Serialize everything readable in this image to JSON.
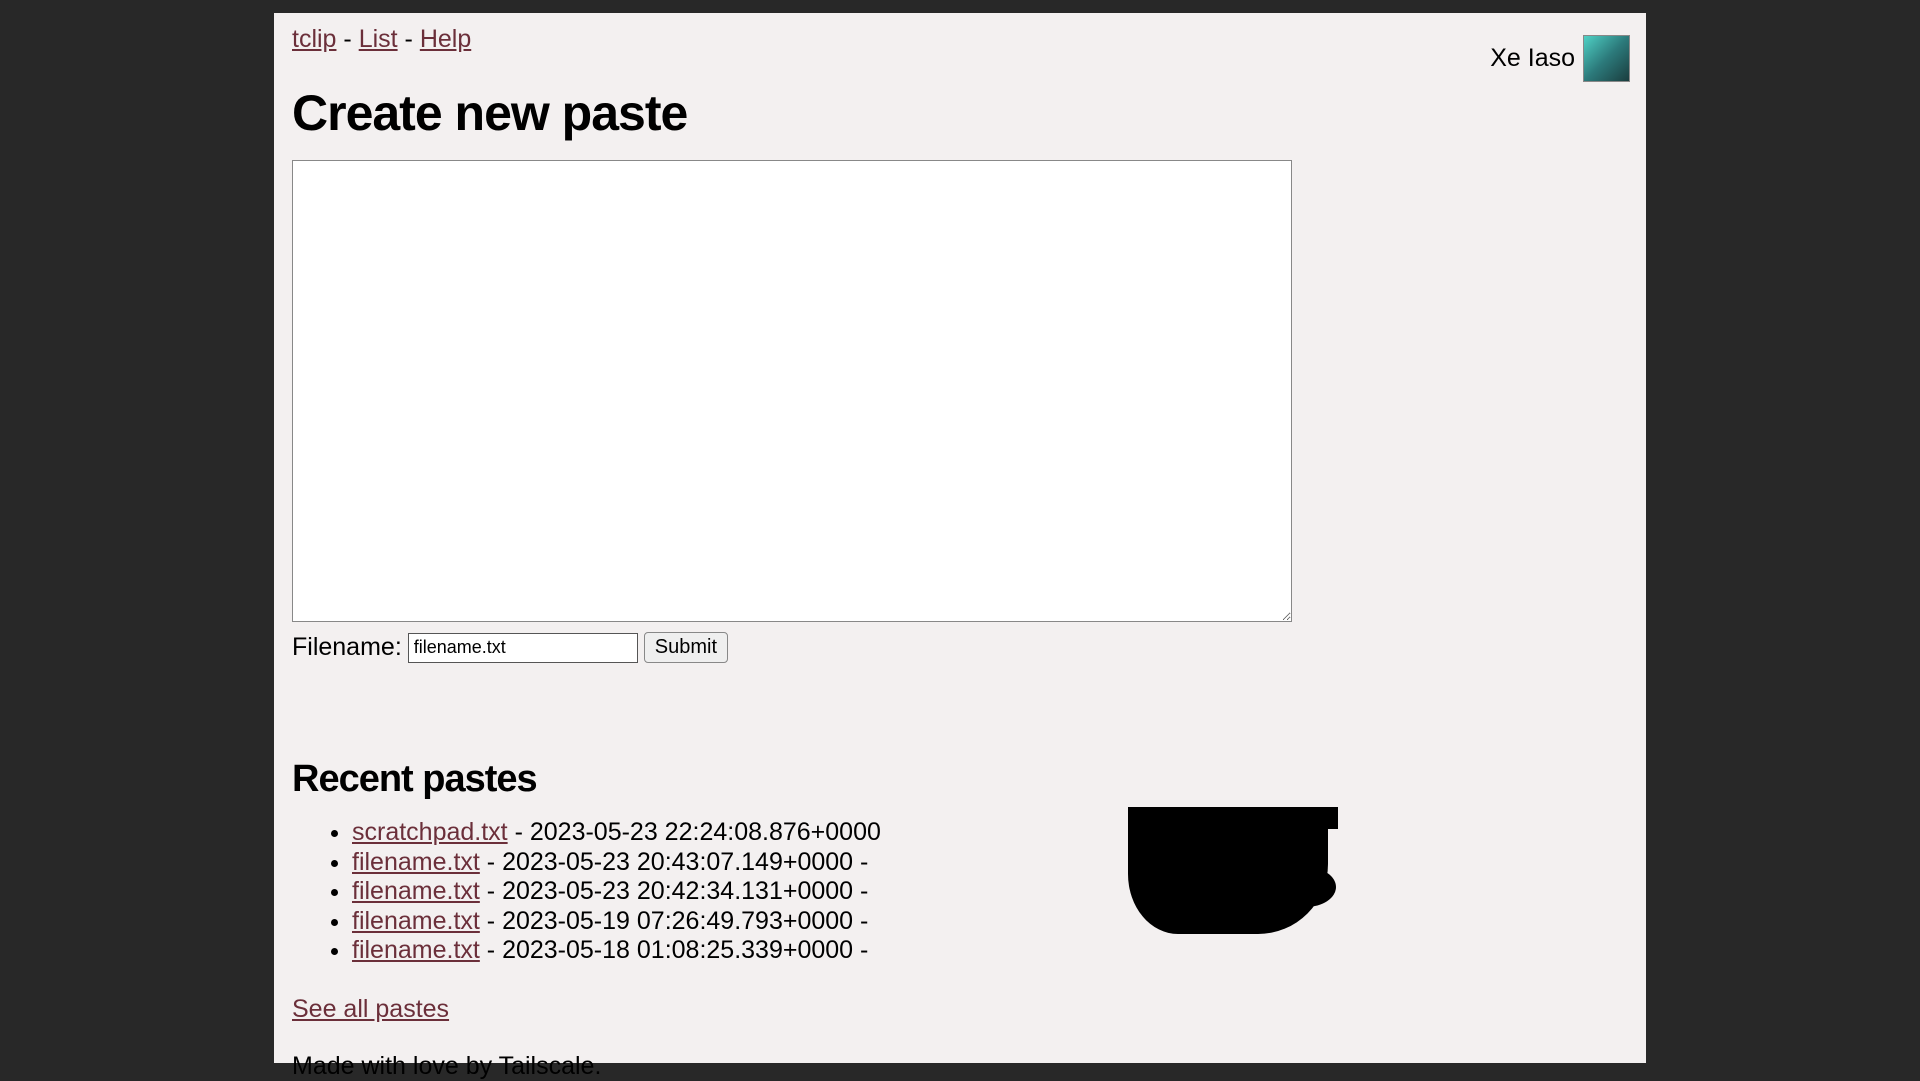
{
  "nav": {
    "tclip": "tclip",
    "sep": " - ",
    "list": "List",
    "help": "Help"
  },
  "user": {
    "name": "Xe Iaso"
  },
  "heading": "Create new paste",
  "filename": {
    "label": "Filename:",
    "value": "filename.txt"
  },
  "submit_label": "Submit",
  "recent": {
    "heading": "Recent pastes",
    "items": [
      {
        "name": "scratchpad.txt",
        "ts": "2023-05-23 22:24:08.876+0000"
      },
      {
        "name": "filename.txt",
        "ts": "2023-05-23 20:43:07.149+0000"
      },
      {
        "name": "filename.txt",
        "ts": "2023-05-23 20:42:34.131+0000"
      },
      {
        "name": "filename.txt",
        "ts": "2023-05-19 07:26:49.793+0000"
      },
      {
        "name": "filename.txt",
        "ts": "2023-05-18 01:08:25.339+0000"
      }
    ],
    "see_all": "See all pastes"
  },
  "footer": "Made with love by Tailscale."
}
